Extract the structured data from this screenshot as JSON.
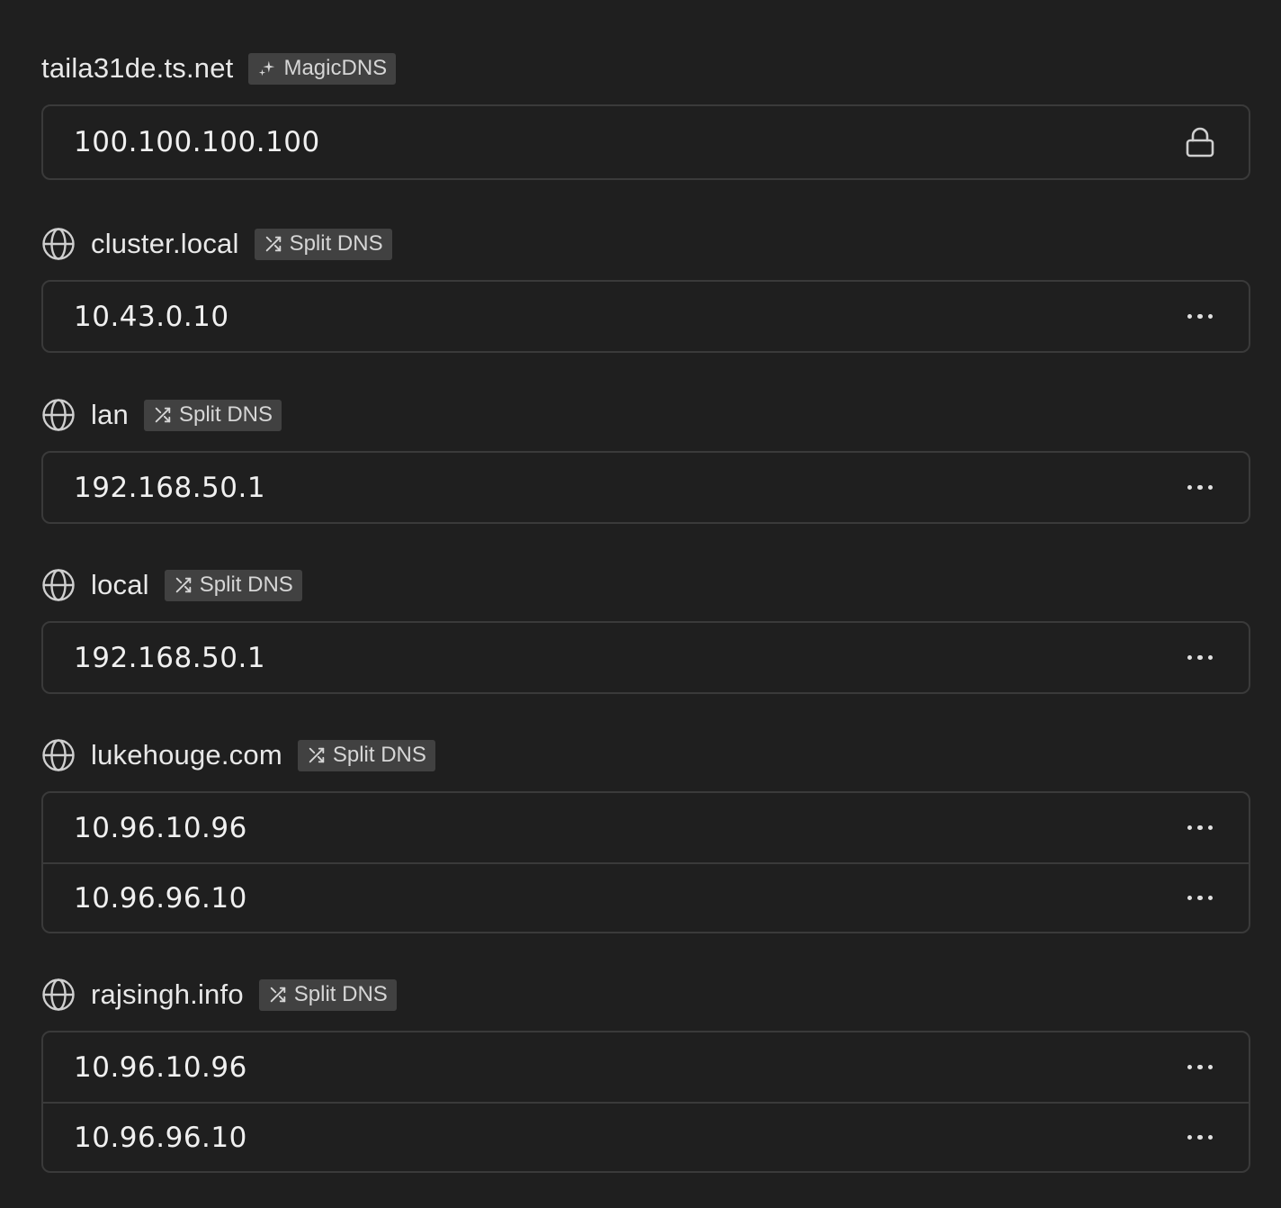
{
  "sections": [
    {
      "domain": "taila31de.ts.net",
      "badge": "MagicDNS",
      "badge_icon": "sparkle-icon",
      "show_globe": false,
      "nameservers": [
        {
          "ip": "100.100.100.100",
          "action_icon": "lock-icon"
        }
      ]
    },
    {
      "domain": "cluster.local",
      "badge": "Split DNS",
      "badge_icon": "shuffle-icon",
      "show_globe": true,
      "nameservers": [
        {
          "ip": "10.43.0.10",
          "action_icon": "more-icon"
        }
      ]
    },
    {
      "domain": "lan",
      "badge": "Split DNS",
      "badge_icon": "shuffle-icon",
      "show_globe": true,
      "nameservers": [
        {
          "ip": "192.168.50.1",
          "action_icon": "more-icon"
        }
      ]
    },
    {
      "domain": "local",
      "badge": "Split DNS",
      "badge_icon": "shuffle-icon",
      "show_globe": true,
      "nameservers": [
        {
          "ip": "192.168.50.1",
          "action_icon": "more-icon"
        }
      ]
    },
    {
      "domain": "lukehouge.com",
      "badge": "Split DNS",
      "badge_icon": "shuffle-icon",
      "show_globe": true,
      "nameservers": [
        {
          "ip": "10.96.10.96",
          "action_icon": "more-icon"
        },
        {
          "ip": "10.96.96.10",
          "action_icon": "more-icon"
        }
      ]
    },
    {
      "domain": "rajsingh.info",
      "badge": "Split DNS",
      "badge_icon": "shuffle-icon",
      "show_globe": true,
      "nameservers": [
        {
          "ip": "10.96.10.96",
          "action_icon": "more-icon"
        },
        {
          "ip": "10.96.96.10",
          "action_icon": "more-icon"
        }
      ]
    }
  ],
  "colors": {
    "background": "#1f1f1f",
    "border": "#3a3a3a",
    "badge_bg": "#414141",
    "text": "#e8e8e8"
  }
}
